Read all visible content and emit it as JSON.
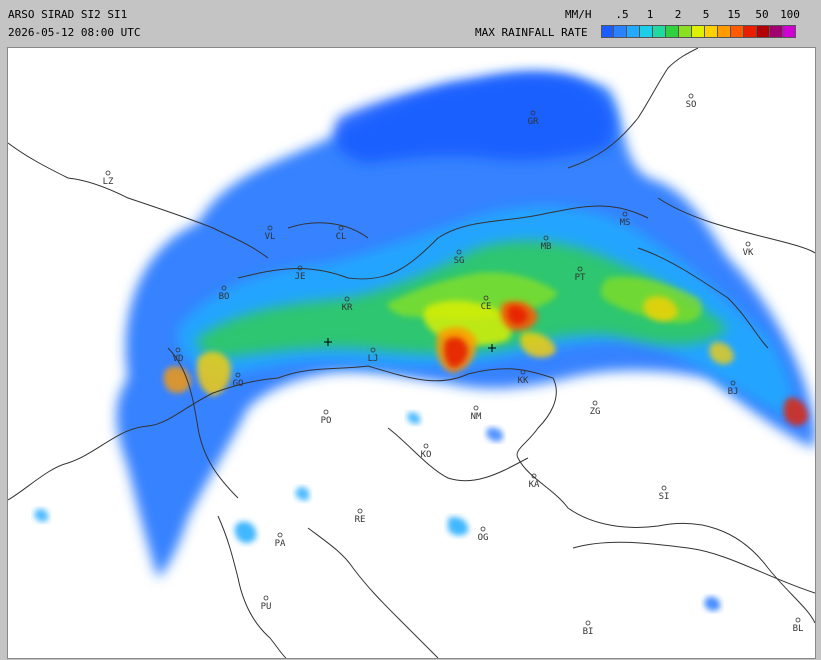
{
  "header": {
    "title": "ARSO SIRAD SI2 SI1",
    "timestamp": "2026-05-12 08:00 UTC",
    "unit": "MM/H",
    "legend_label": "MAX RAINFALL RATE"
  },
  "legend": {
    "ticks": [
      ".5",
      "1",
      "2",
      "5",
      "15",
      "50",
      "100"
    ],
    "colors": [
      "#1a5cff",
      "#2a82ff",
      "#22aaff",
      "#1ccfe8",
      "#20d8a0",
      "#30d040",
      "#8ae020",
      "#e0f000",
      "#ffd000",
      "#ff9a00",
      "#ff5a00",
      "#e81e00",
      "#b40000",
      "#a00070",
      "#d000d0"
    ]
  },
  "cities": [
    {
      "code": "SO"
    },
    {
      "code": "GR"
    },
    {
      "code": "LZ"
    },
    {
      "code": "VL"
    },
    {
      "code": "CL"
    },
    {
      "code": "MB"
    },
    {
      "code": "MS"
    },
    {
      "code": "SG"
    },
    {
      "code": "JE"
    },
    {
      "code": "BO"
    },
    {
      "code": "KR"
    },
    {
      "code": "PT"
    },
    {
      "code": "VK"
    },
    {
      "code": "CE"
    },
    {
      "code": "LJ"
    },
    {
      "code": "VD"
    },
    {
      "code": "GO"
    },
    {
      "code": "KK"
    },
    {
      "code": "NM"
    },
    {
      "code": "ZG"
    },
    {
      "code": "BJ"
    },
    {
      "code": "PO"
    },
    {
      "code": "KO"
    },
    {
      "code": "KA"
    },
    {
      "code": "SI"
    },
    {
      "code": "RE"
    },
    {
      "code": "OG"
    },
    {
      "code": "PA"
    },
    {
      "code": "PU"
    },
    {
      "code": "BI"
    },
    {
      "code": "BL"
    }
  ]
}
